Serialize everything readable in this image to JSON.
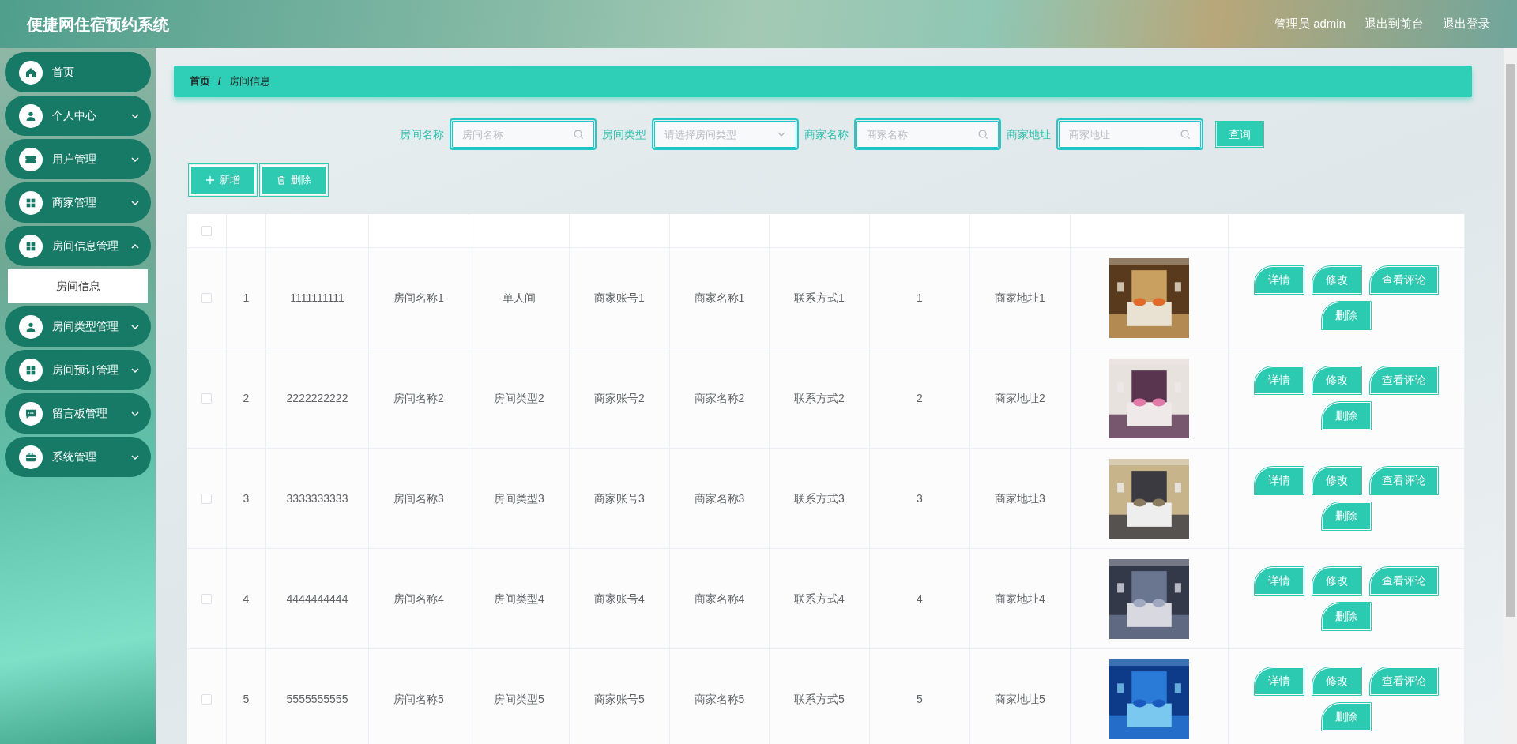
{
  "header": {
    "title": "便捷网住宿预约系统",
    "user": "管理员 admin",
    "links": [
      "退出到前台",
      "退出登录"
    ]
  },
  "sidebar": {
    "items": [
      {
        "label": "首页",
        "selected": false
      },
      {
        "label": "个人中心",
        "selected": false,
        "expanded": false
      },
      {
        "label": "用户管理",
        "selected": false,
        "expanded": false
      },
      {
        "label": "商家管理",
        "selected": false,
        "expanded": false
      },
      {
        "label": "房间信息管理",
        "selected": false,
        "expanded": true,
        "children": [
          {
            "label": "房间信息",
            "selected": true
          }
        ]
      },
      {
        "label": "房间类型管理",
        "selected": false,
        "expanded": false
      },
      {
        "label": "房间预订管理",
        "selected": false,
        "expanded": false
      },
      {
        "label": "留言板管理",
        "selected": false,
        "expanded": false
      },
      {
        "label": "系统管理",
        "selected": false,
        "expanded": false
      }
    ]
  },
  "breadcrumb": {
    "items": [
      "首页",
      "房间信息"
    ],
    "separator": "/"
  },
  "search": {
    "fields": [
      {
        "label": "房间名称",
        "placeholder": "房间名称",
        "kind": "text"
      },
      {
        "label": "房间类型",
        "placeholder": "请选择房间类型",
        "kind": "select"
      },
      {
        "label": "商家名称",
        "placeholder": "商家名称",
        "kind": "text"
      },
      {
        "label": "商家地址",
        "placeholder": "商家地址",
        "kind": "text"
      }
    ],
    "button": "查询"
  },
  "toolbar": [
    {
      "label": "新增",
      "kind": "add"
    },
    {
      "label": "删除",
      "kind": "delete"
    }
  ],
  "table": {
    "header_checked": false,
    "rows": [
      {
        "checked": false,
        "cells": [
          "1",
          "1111111111",
          "房间名称1",
          "单人间",
          "商家账号1",
          "商家名称1",
          "联系方式1",
          "1",
          "商家地址1"
        ],
        "image": {
          "kind": "picture"
        },
        "actions": [
          "详情",
          "修改",
          "查看评论",
          "删除"
        ]
      },
      {
        "checked": false,
        "cells": [
          "2",
          "2222222222",
          "房间名称2",
          "房间类型2",
          "商家账号2",
          "商家名称2",
          "联系方式2",
          "2",
          "商家地址2"
        ],
        "image": {
          "kind": "picture"
        },
        "actions": [
          "详情",
          "修改",
          "查看评论",
          "删除"
        ]
      },
      {
        "checked": false,
        "cells": [
          "3",
          "3333333333",
          "房间名称3",
          "房间类型3",
          "商家账号3",
          "商家名称3",
          "联系方式3",
          "3",
          "商家地址3"
        ],
        "image": {
          "kind": "picture"
        },
        "actions": [
          "详情",
          "修改",
          "查看评论",
          "删除"
        ]
      },
      {
        "checked": false,
        "cells": [
          "4",
          "4444444444",
          "房间名称4",
          "房间类型4",
          "商家账号4",
          "商家名称4",
          "联系方式4",
          "4",
          "商家地址4"
        ],
        "image": {
          "kind": "picture"
        },
        "actions": [
          "详情",
          "修改",
          "查看评论",
          "删除"
        ]
      },
      {
        "checked": false,
        "cells": [
          "5",
          "5555555555",
          "房间名称5",
          "房间类型5",
          "商家账号5",
          "商家名称5",
          "联系方式5",
          "5",
          "商家地址5"
        ],
        "image": {
          "kind": "picture"
        },
        "actions": [
          "详情",
          "修改",
          "查看评论",
          "删除"
        ]
      }
    ]
  }
}
